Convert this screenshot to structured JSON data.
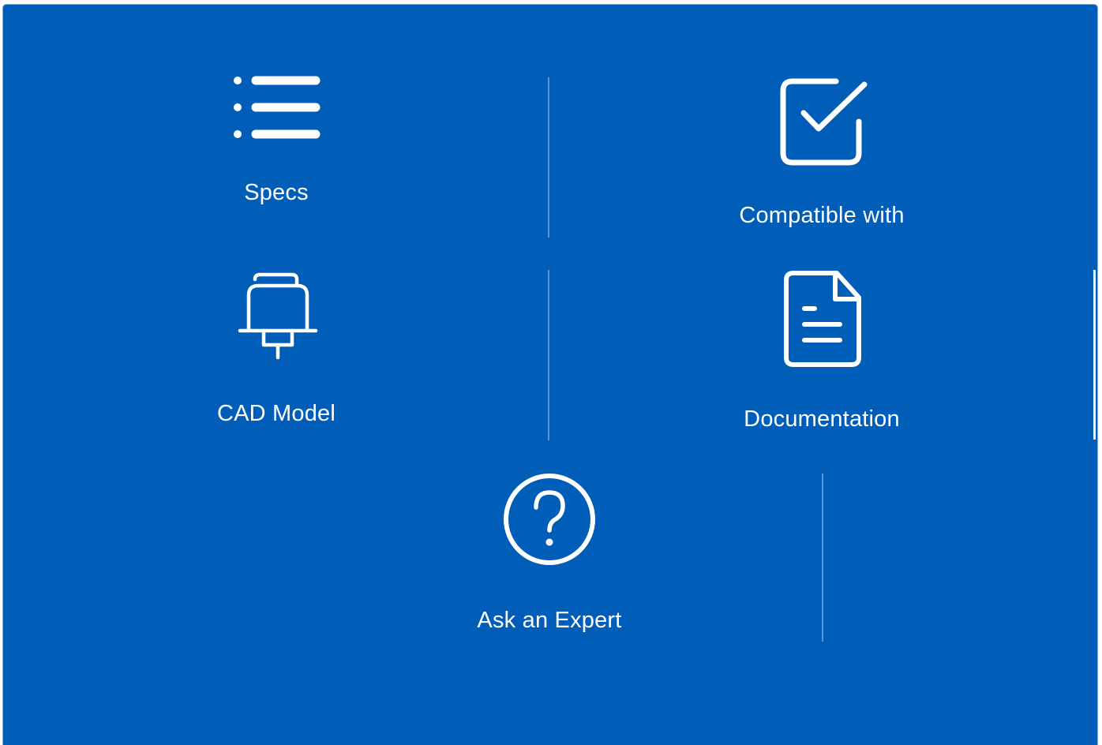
{
  "colors": {
    "panel_background": "#005eb8",
    "foreground": "#ffffff",
    "divider": "rgba(255,255,255,0.35)"
  },
  "tiles": [
    {
      "label": "Specs",
      "icon": "list-icon"
    },
    {
      "label": "Compatible with",
      "icon": "checkbox-check-icon"
    },
    {
      "label": "CAD Model",
      "icon": "cad-part-icon"
    },
    {
      "label": "Documentation",
      "icon": "document-icon"
    },
    {
      "label": "Ask an Expert",
      "icon": "question-circle-icon"
    }
  ]
}
